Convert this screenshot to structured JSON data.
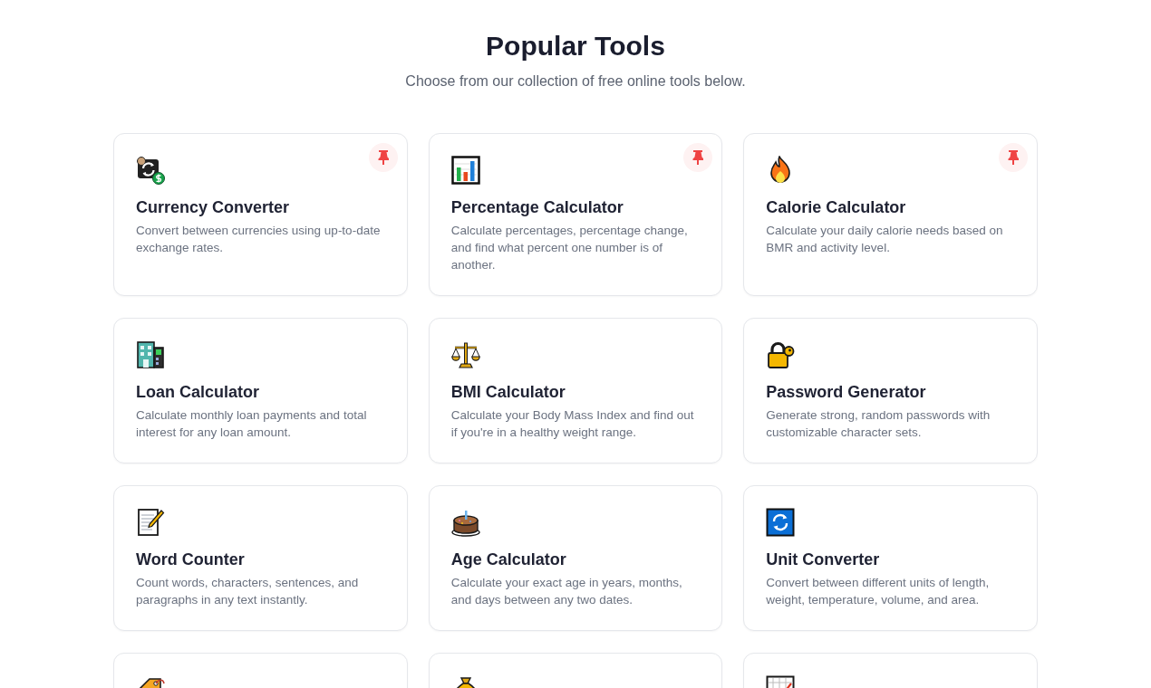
{
  "header": {
    "title": "Popular Tools",
    "subtitle": "Choose from our collection of free online tools below."
  },
  "tools": [
    {
      "title": "Currency Converter",
      "description": "Convert between currencies using up-to-date exchange rates.",
      "pinned": true
    },
    {
      "title": "Percentage Calculator",
      "description": "Calculate percentages, percentage change, and find what percent one number is of another.",
      "pinned": true
    },
    {
      "title": "Calorie Calculator",
      "description": "Calculate your daily calorie needs based on BMR and activity level.",
      "pinned": true
    },
    {
      "title": "Loan Calculator",
      "description": "Calculate monthly loan payments and total interest for any loan amount.",
      "pinned": false
    },
    {
      "title": "BMI Calculator",
      "description": "Calculate your Body Mass Index and find out if you're in a healthy weight range.",
      "pinned": false
    },
    {
      "title": "Password Generator",
      "description": "Generate strong, random passwords with customizable character sets.",
      "pinned": false
    },
    {
      "title": "Word Counter",
      "description": "Count words, characters, sentences, and paragraphs in any text instantly.",
      "pinned": false
    },
    {
      "title": "Age Calculator",
      "description": "Calculate your exact age in years, months, and days between any two dates.",
      "pinned": false
    },
    {
      "title": "Unit Converter",
      "description": "Convert between different units of length, weight, temperature, volume, and area.",
      "pinned": false
    },
    {
      "pinned": false
    },
    {
      "pinned": false
    },
    {
      "pinned": false
    }
  ]
}
